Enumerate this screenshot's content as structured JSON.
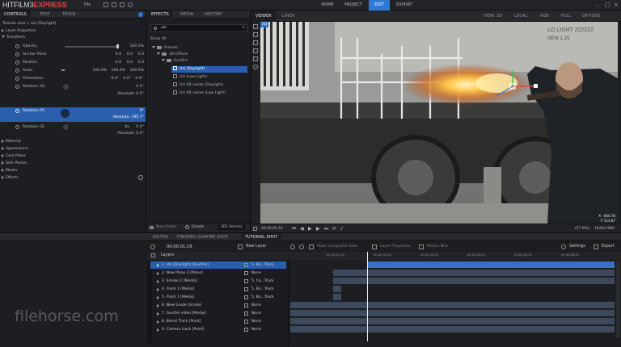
{
  "app": {
    "logo_main": "HITFILM3",
    "logo_express": "EXPRESS",
    "menus": [
      "File"
    ],
    "nav_tabs": [
      {
        "label": "HOME"
      },
      {
        "label": "PROJECT"
      },
      {
        "label": "EDIT"
      },
      {
        "label": "EXPORT"
      }
    ],
    "active_tab": "EDIT",
    "window_controls": [
      "–",
      "□",
      "×"
    ]
  },
  "left_panel": {
    "tabs": [
      "CONTROLS",
      "TEXT",
      "TRACK"
    ],
    "breadcrumb": "Tutorial shot > Uzi [Daylight]",
    "sections_top": [
      "Layer Properties",
      "Transform"
    ],
    "transform": [
      {
        "label": "Opacity",
        "values": [
          "100.0%"
        ]
      },
      {
        "label": "Anchor Point",
        "values": [
          "0.0",
          "0.0",
          "0.0"
        ]
      },
      {
        "label": "Position",
        "values": [
          "0.0",
          "0.0",
          "0.0"
        ]
      },
      {
        "label": "Scale",
        "values": [
          "100.0%",
          "100.0%",
          "100.0%"
        ]
      },
      {
        "label": "Orientation",
        "values": [
          "0.0°",
          "0.0°",
          "0.0°"
        ]
      },
      {
        "label": "Rotation (X)",
        "values": [
          "0.0°"
        ],
        "absolute": "Absolute: 0.0°"
      },
      {
        "label": "Rotation (Y)",
        "values": [
          "0°"
        ],
        "absolute": "Absolute: 195.7°"
      },
      {
        "label": "Rotation (Z)",
        "values": [
          "0x",
          "0.0°"
        ],
        "absolute": "Absolute: 0.0°"
      }
    ],
    "sections_bottom": [
      "Material",
      "Appearance",
      "Core Plane",
      "Side Planes",
      "Masks",
      "Effects"
    ]
  },
  "effects_panel": {
    "tabs": [
      "EFFECTS",
      "MEDIA",
      "HISTORY"
    ],
    "search_value": "uzi",
    "show_all": "Show All",
    "tree": [
      {
        "label": "Presets",
        "depth": 0,
        "kind": "folder"
      },
      {
        "label": "3D Effects",
        "depth": 1,
        "kind": "folder"
      },
      {
        "label": "Gunfire",
        "depth": 2,
        "kind": "folder"
      },
      {
        "label": "Uzi (Daylight)",
        "depth": 3,
        "kind": "fx",
        "selected": true
      },
      {
        "label": "Uzi (Low Light)",
        "depth": 3,
        "kind": "fx"
      },
      {
        "label": "Uzi AR series (Daylight)",
        "depth": 3,
        "kind": "fx"
      },
      {
        "label": "Uzi AR series (Low Light)",
        "depth": 3,
        "kind": "fx"
      }
    ],
    "footer": {
      "new_folder": "New Folder",
      "delete": "Delete",
      "count": "202 item(s)"
    }
  },
  "viewer": {
    "tabs": [
      "VIEWER",
      "LAYER"
    ],
    "toolbar": [
      "VIEW: 2D",
      "LOCAL",
      "RGB",
      "FULL",
      "OPTIONS"
    ],
    "badge": "2D",
    "train_text": [
      "LO LIGHT 222222",
      "NEW 1.15"
    ],
    "readout": [
      "X: -846.78",
      "Y: 514.87"
    ],
    "timecode": "00;00;01;16",
    "zoom": "(57.0%)",
    "res": "1920x1080"
  },
  "timeline": {
    "tabs": [
      "EDITOR",
      "FINISHED GUNFIRE SHOT",
      "TUTORIAL SHOT"
    ],
    "timecode": "00;00;01;16",
    "new_layer": "New Layer",
    "tools": [
      "Make Composite Shot",
      "Layer Properties",
      "Motion Blur"
    ],
    "settings": "Settings",
    "export": "Export",
    "layers_header": "Layers",
    "ruler": [
      "00;00;01;00",
      "00;00;02;00",
      "00;00;03;00",
      "00;00;04;00",
      "00;00;05;00",
      "00;00;06;00"
    ],
    "layers": [
      {
        "name": "1. Uzi (Daylight) [Gunfire]",
        "parent": "5. Ba...Track",
        "selected": true
      },
      {
        "name": "2. New Plane 2 [Plane]",
        "parent": "None"
      },
      {
        "name": "3. Smoke 1 [Media]",
        "parent": "5. Ca...Track"
      },
      {
        "name": "4. Flash 1 [Media]",
        "parent": "5. Ba...Track"
      },
      {
        "name": "5. Flash 1 [Media]",
        "parent": "5. Ba...Track"
      },
      {
        "name": "6. New Grade [Grade]",
        "parent": "None"
      },
      {
        "name": "7. Gunfire video [Media]",
        "parent": "None"
      },
      {
        "name": "8. Barrel Track [Point]",
        "parent": "None"
      },
      {
        "name": "9. Camera track [Point]",
        "parent": "None"
      }
    ],
    "watermark": "filehorse.com"
  },
  "colors": {
    "accent": "#2f78d6",
    "selected": "#2a5fae",
    "track_blue": "#3a70c4",
    "track_gray": "#3d4a5e"
  }
}
